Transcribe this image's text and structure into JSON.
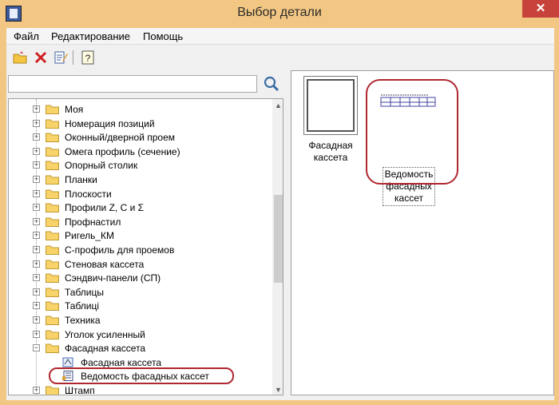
{
  "window": {
    "title": "Выбор детали",
    "close_glyph": "✕"
  },
  "menu": {
    "items": [
      "Файл",
      "Редактирование",
      "Помощь"
    ]
  },
  "toolbar": {
    "icons": [
      "open-folder-icon",
      "delete-icon",
      "edit-icon",
      "help-icon"
    ],
    "help_glyph": "?"
  },
  "search": {
    "value": "",
    "placeholder": ""
  },
  "tree": {
    "items": [
      {
        "label": "Моя",
        "type": "folder"
      },
      {
        "label": "Номерация позиций",
        "type": "folder"
      },
      {
        "label": "Оконный/дверной проем",
        "type": "folder"
      },
      {
        "label": "Омега профиль (сечение)",
        "type": "folder"
      },
      {
        "label": "Опорный столик",
        "type": "folder"
      },
      {
        "label": "Планки",
        "type": "folder"
      },
      {
        "label": "Плоскости",
        "type": "folder"
      },
      {
        "label": "Профили Z, C и Σ",
        "type": "folder"
      },
      {
        "label": "Профнастил",
        "type": "folder"
      },
      {
        "label": "Ригель_КМ",
        "type": "folder"
      },
      {
        "label": "С-профиль для проемов",
        "type": "folder"
      },
      {
        "label": "Стеновая кассета",
        "type": "folder"
      },
      {
        "label": "Сэндвич-панели (СП)",
        "type": "folder"
      },
      {
        "label": "Таблицы",
        "type": "folder"
      },
      {
        "label": "Таблиці",
        "type": "folder"
      },
      {
        "label": "Техника",
        "type": "folder"
      },
      {
        "label": "Уголок усиленный",
        "type": "folder"
      },
      {
        "label": "Фасадная кассета",
        "type": "folder-open"
      },
      {
        "label": "Фасадная кассета",
        "type": "part"
      },
      {
        "label": "Ведомость фасадных кассет",
        "type": "table"
      },
      {
        "label": "Штамп",
        "type": "folder"
      }
    ]
  },
  "preview": {
    "items": [
      {
        "caption": "Фасадная кассета",
        "lines": [
          "Фасадная",
          "кассета"
        ]
      },
      {
        "caption": "Ведомость фасадных кассет",
        "lines": [
          "Ведомость",
          "фасадных",
          "кассет"
        ]
      }
    ]
  },
  "colors": {
    "titlebar": "#f2c783",
    "close": "#c7423a",
    "highlight": "#b0282f"
  }
}
